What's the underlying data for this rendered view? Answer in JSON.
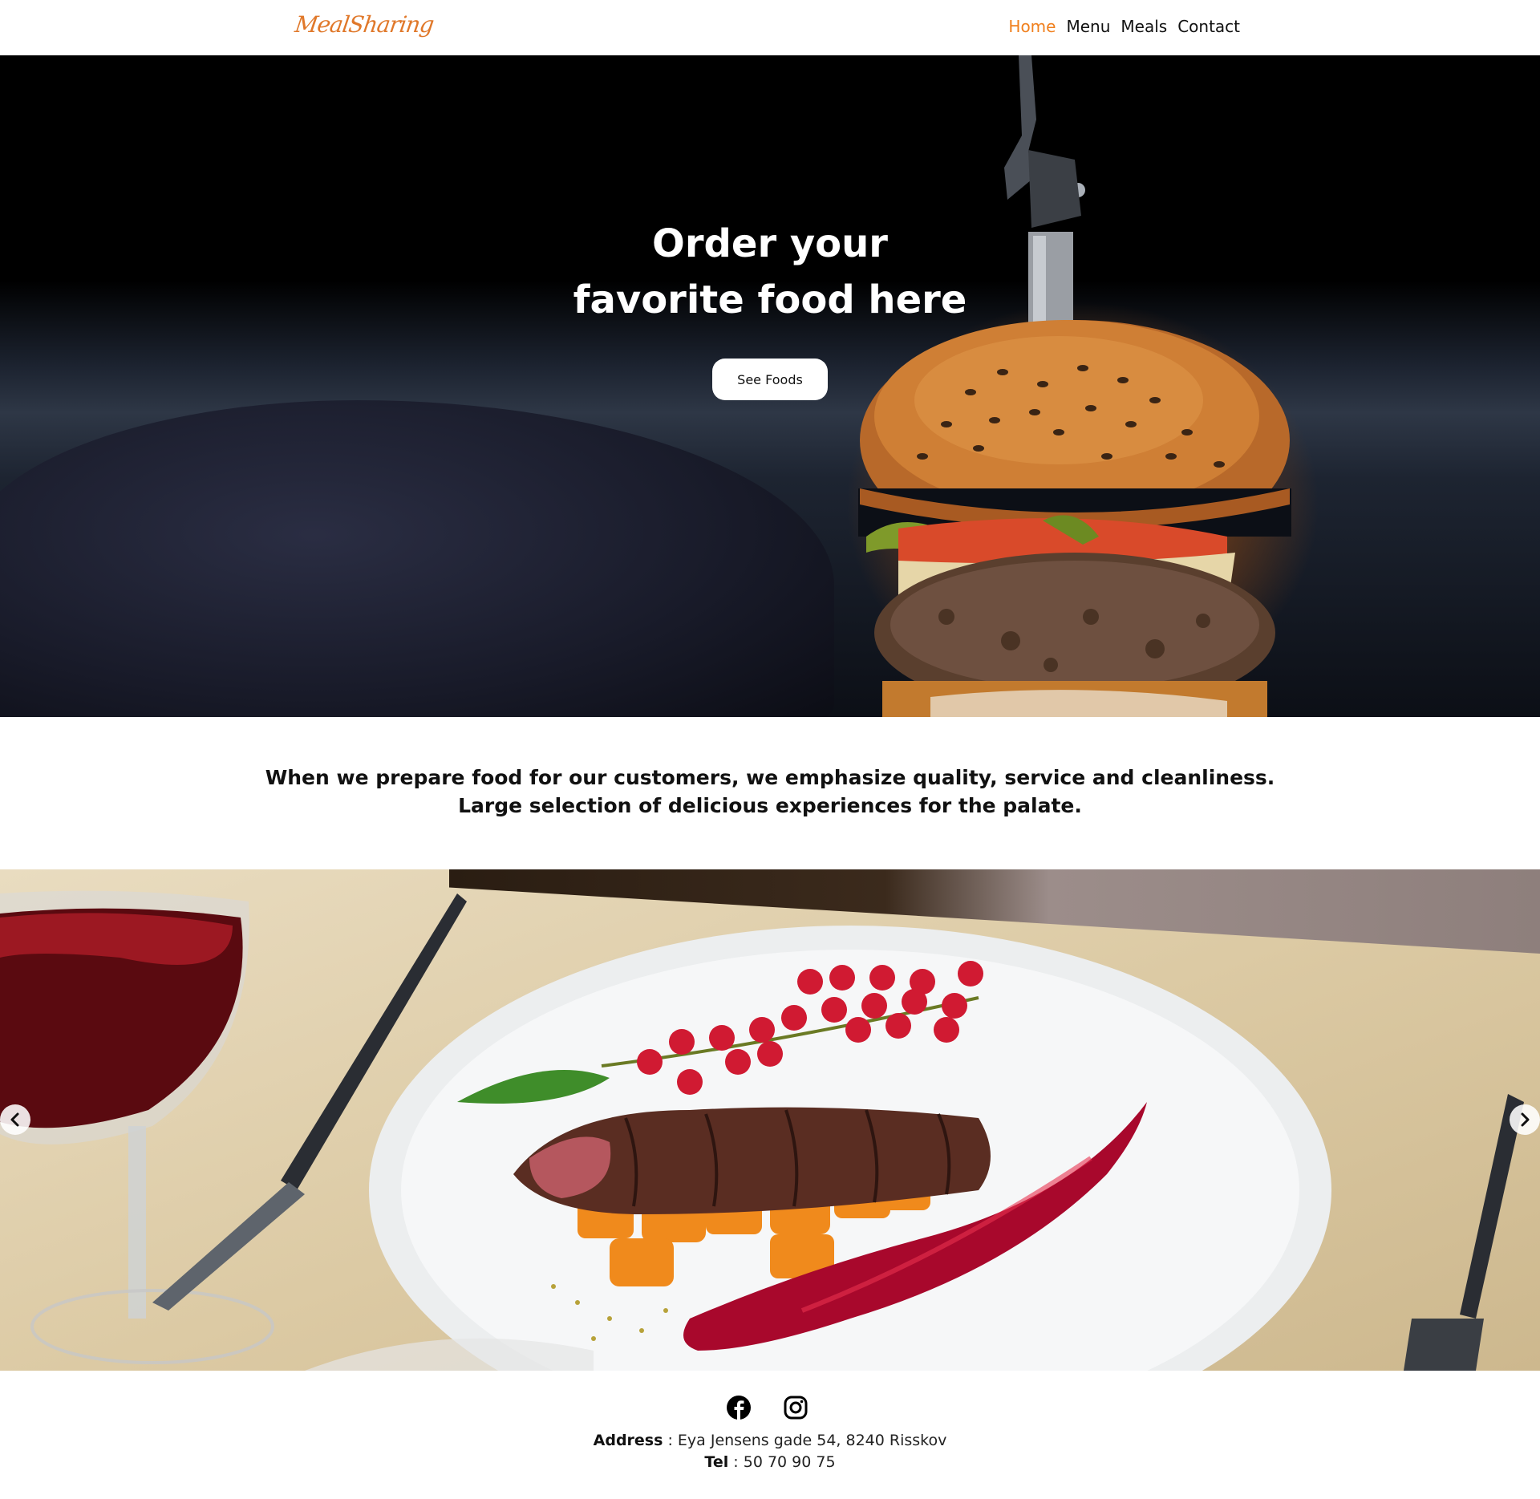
{
  "header": {
    "logo": "MealSharing",
    "nav": [
      {
        "label": "Home",
        "active": true
      },
      {
        "label": "Menu",
        "active": false
      },
      {
        "label": "Meals",
        "active": false
      },
      {
        "label": "Contact",
        "active": false
      }
    ],
    "accent_color": "#f07f1c"
  },
  "hero": {
    "title_line1": "Order your",
    "title_line2": "favorite food here",
    "button_label": "See Foods"
  },
  "intro": {
    "line1": "When we prepare food for our customers, we emphasize quality, service and cleanliness.",
    "line2": "Large selection of delicious experiences for the palate."
  },
  "carousel": {
    "prev_icon": "chevron-left-icon",
    "next_icon": "chevron-right-icon"
  },
  "footer": {
    "social_icons": [
      "facebook-icon",
      "instagram-icon"
    ],
    "address_label": "Address",
    "address_value": " : Eya Jensens gade 54, 8240 Risskov",
    "tel_label": "Tel",
    "tel_value": " : 50 70 90 75"
  }
}
